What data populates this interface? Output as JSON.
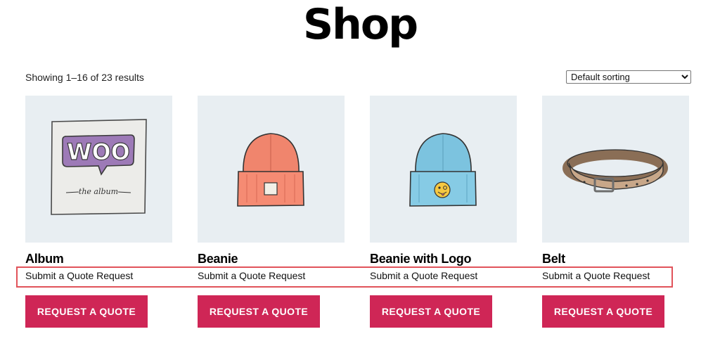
{
  "page": {
    "title": "Shop"
  },
  "toolbar": {
    "result_count": "Showing 1–16 of 23 results",
    "sorting": {
      "selected": "Default sorting"
    }
  },
  "products": [
    {
      "name": "Album",
      "quote_text": "Submit a Quote Request",
      "button_label": "REQUEST A QUOTE",
      "image_icon": "album-woo-icon"
    },
    {
      "name": "Beanie",
      "quote_text": "Submit a Quote Request",
      "button_label": "REQUEST A QUOTE",
      "image_icon": "beanie-icon"
    },
    {
      "name": "Beanie with Logo",
      "quote_text": "Submit a Quote Request",
      "button_label": "REQUEST A QUOTE",
      "image_icon": "beanie-with-logo-icon"
    },
    {
      "name": "Belt",
      "quote_text": "Submit a Quote Request",
      "button_label": "REQUEST A QUOTE",
      "image_icon": "belt-icon"
    }
  ],
  "album_art": {
    "logo_text": "WOO",
    "caption": "the album"
  },
  "colors": {
    "button": "#cf2656",
    "image_background": "#e8eef2",
    "highlight_border": "#e1535a"
  }
}
